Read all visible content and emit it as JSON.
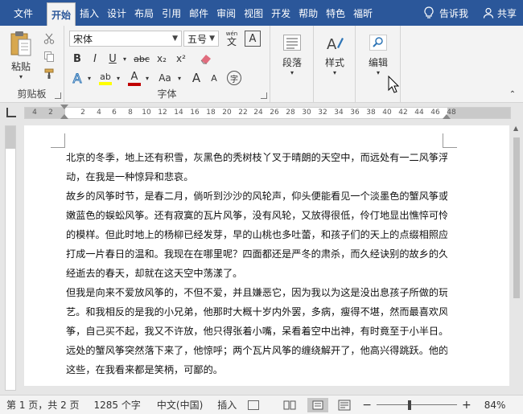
{
  "tabs": {
    "file": "文件",
    "home": "开始",
    "insert": "插入",
    "design": "设计",
    "layout": "布局",
    "references": "引用",
    "mailings": "邮件",
    "review": "审阅",
    "view": "视图",
    "developer": "开发",
    "help": "帮助",
    "special": "特色",
    "foxit": "福昕",
    "tell_me": "告诉我",
    "share": "共享"
  },
  "ribbon": {
    "clipboard": {
      "paste": "粘贴",
      "label": "剪贴板"
    },
    "font": {
      "font_name": "宋体",
      "font_size": "五号",
      "phonetic_top": "wén",
      "phonetic_char": "文",
      "char_border": "A",
      "bold": "B",
      "italic": "I",
      "underline": "U",
      "strike": "abc",
      "subscript": "x₂",
      "superscript": "x²",
      "text_effect": "A",
      "highlight": "ab",
      "font_color": "A",
      "change_case": "Aa",
      "grow": "A",
      "shrink": "A",
      "enclose": "字",
      "label": "字体"
    },
    "paragraph": {
      "label": "段落"
    },
    "styles": {
      "label": "样式"
    },
    "editing": {
      "label": "编辑"
    }
  },
  "ruler": {
    "labels": [
      "4",
      "2",
      "2",
      "4",
      "6",
      "8",
      "10",
      "12",
      "14",
      "16",
      "18",
      "20",
      "22",
      "24",
      "26",
      "28",
      "30",
      "32",
      "34",
      "36",
      "38",
      "40",
      "42",
      "44",
      "46",
      "48"
    ]
  },
  "document": {
    "lines": [
      "北京的冬季，地上还有积雪，灰黑色的秃树枝丫叉于晴朗的天空中，而远处有一二风筝浮",
      "动，在我是一种惊异和悲哀。",
      "故乡的风筝时节，是春二月，倘听到沙沙的风轮声，仰头便能看见一个淡墨色的蟹风筝或",
      "嫩蓝色的蜈蚣风筝。还有寂寞的瓦片风筝，没有风轮，又放得很低，伶仃地显出憔悴可怜",
      "的模样。但此时地上的杨柳已经发芽，早的山桃也多吐蕾，和孩子们的天上的点缀相照应，",
      "打成一片春日的温和。我现在在哪里呢？四面都还是严冬的肃杀，而久经诀别的故乡的久",
      "经逝去的春天，却就在这天空中荡漾了。",
      "但我是向来不爱放风筝的，不但不爱，并且嫌恶它，因为我以为这是没出息孩子所做的玩",
      "艺。和我相反的是我的小兄弟，他那时大概十岁内外罢，多病，瘦得不堪，然而最喜欢风",
      "筝，自己买不起，我又不许放，他只得张着小嘴，呆看着空中出神，有时竟至于小半日。",
      "远处的蟹风筝突然落下来了，他惊呼；两个瓦片风筝的缠绕解开了，他高兴得跳跃。他的",
      "这些，在我看来都是笑柄，可鄙的。"
    ]
  },
  "status": {
    "page": "第 1 页，共 2 页",
    "words": "1285 个字",
    "language": "中文(中国)",
    "mode": "插入",
    "zoom": "84%"
  },
  "colors": {
    "accent": "#2b579a",
    "highlight": "#ffff00",
    "font_color": "#c00000",
    "effect": "#2e75b6"
  }
}
